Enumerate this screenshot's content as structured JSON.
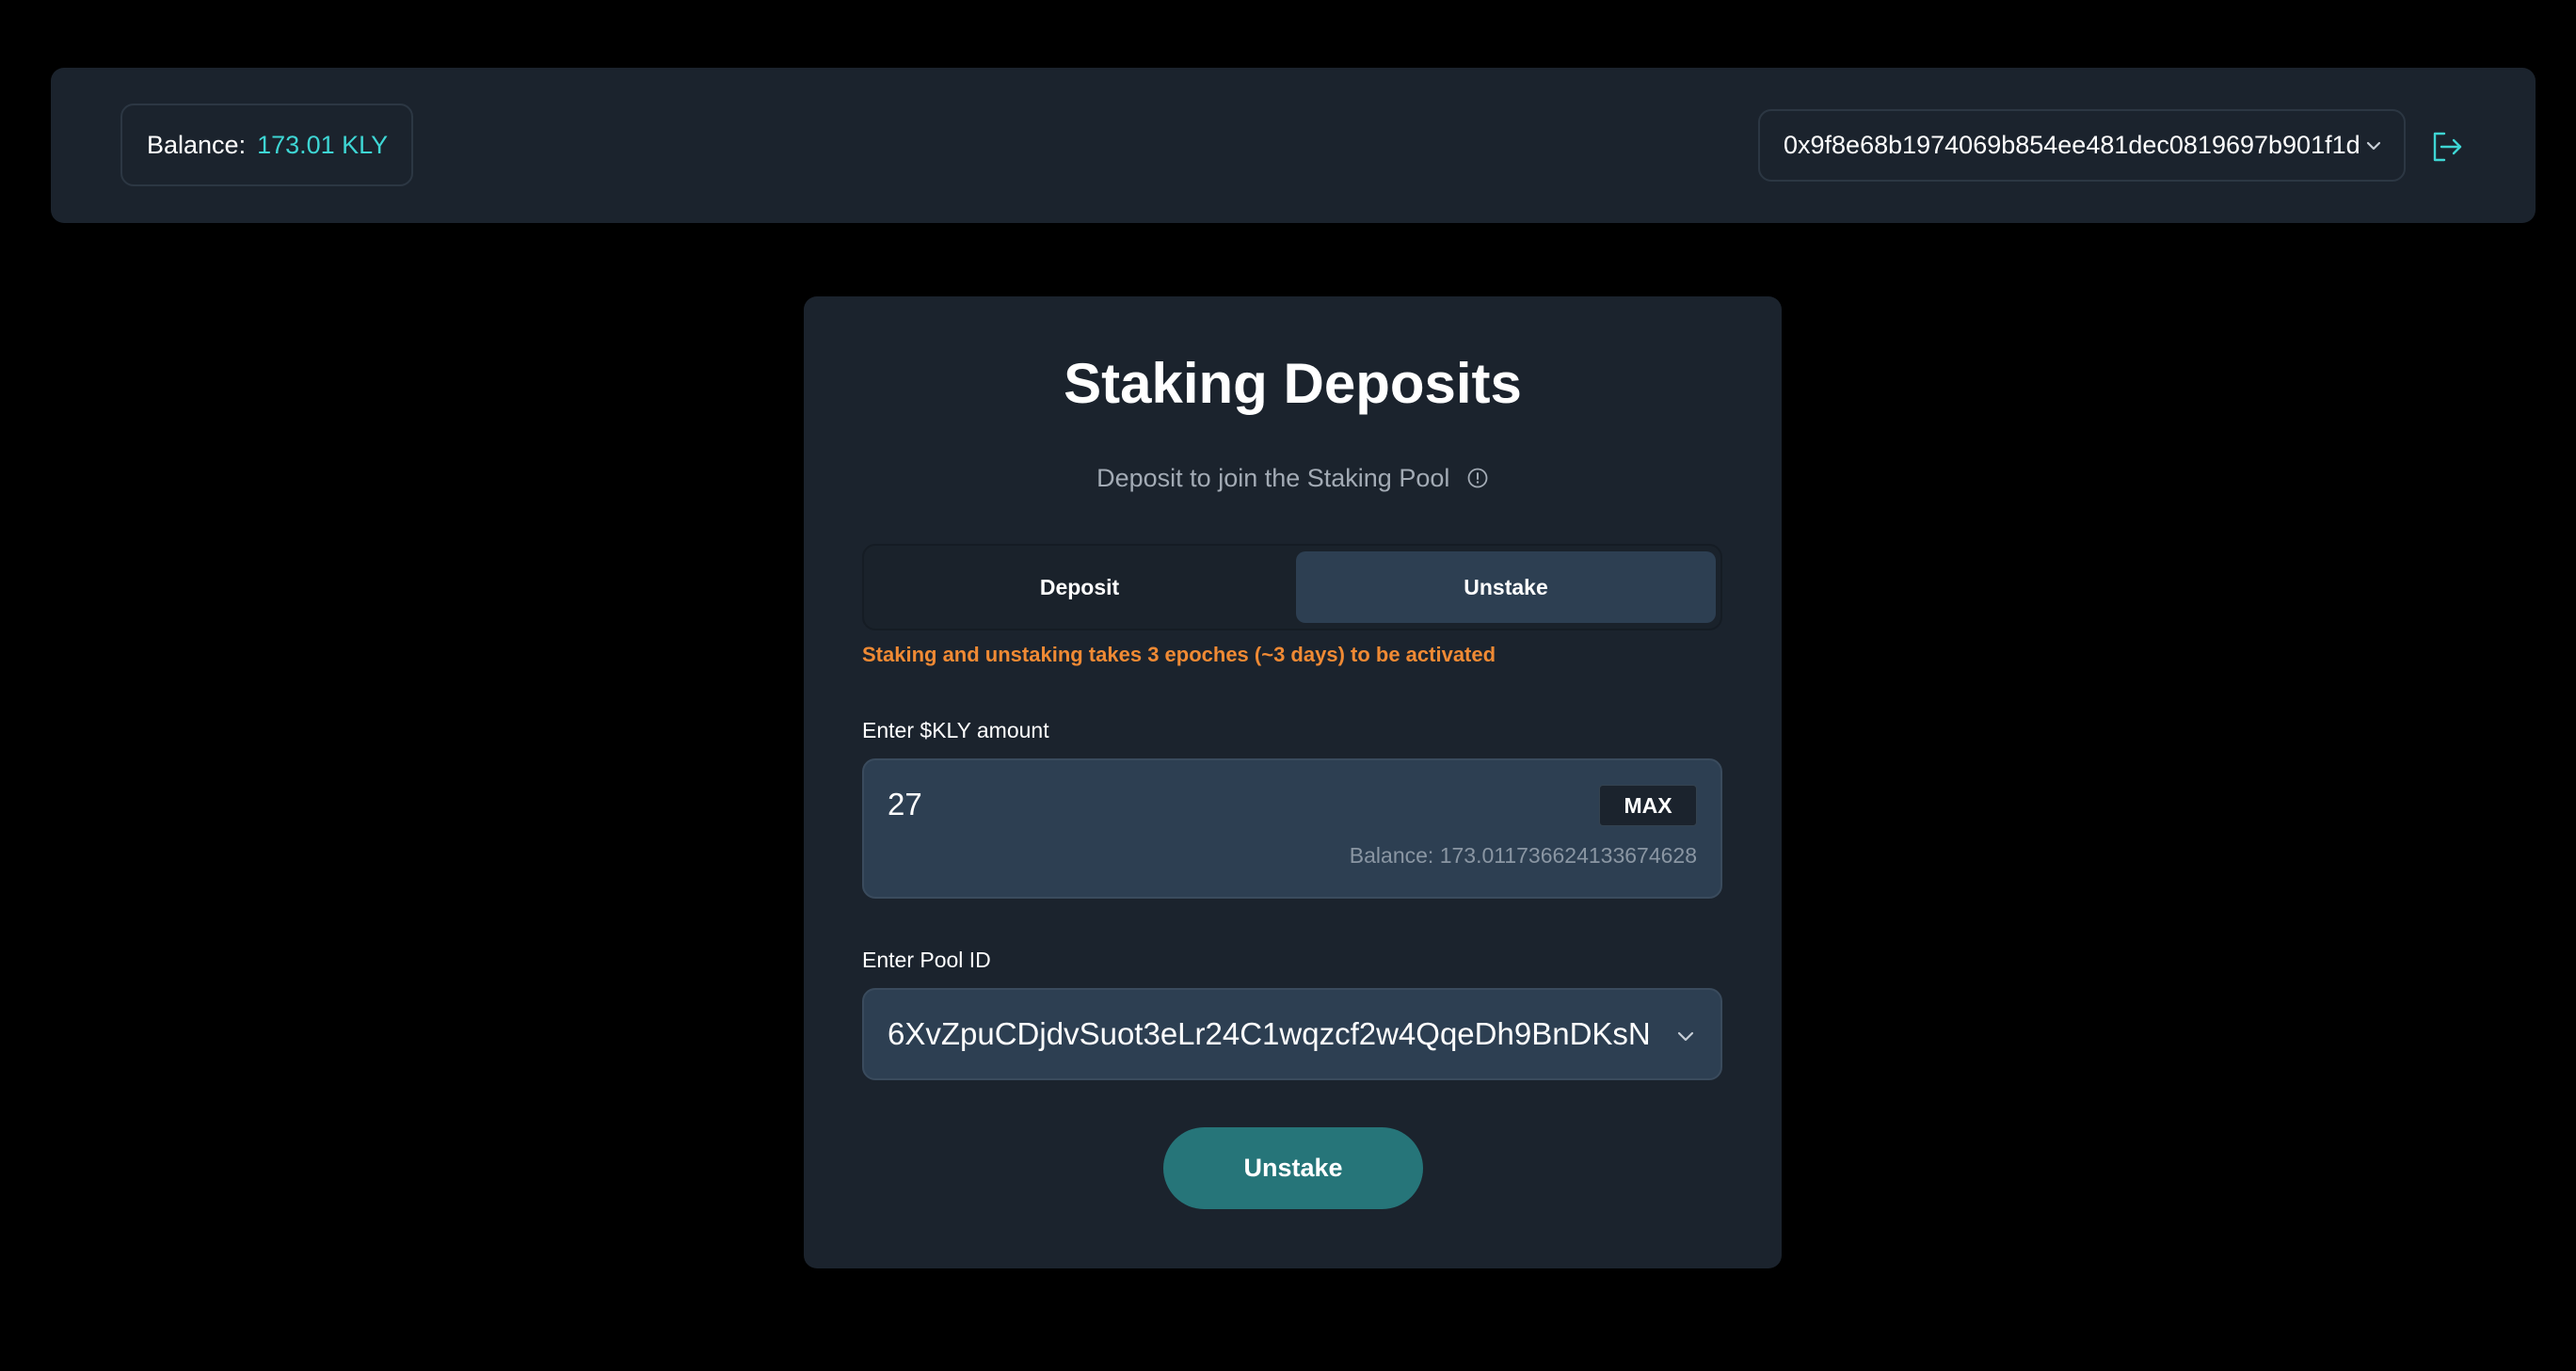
{
  "header": {
    "balance_label": "Balance:",
    "balance_value": "173.01 KLY",
    "wallet_address": "0x9f8e68b1974069b854ee481dec0819697b901f1d",
    "wallet_chevron_icon": "chevron-down-icon",
    "logout_icon": "logout-icon"
  },
  "card": {
    "title": "Staking Deposits",
    "subtitle": "Deposit to join the Staking Pool",
    "info_icon": "info-icon",
    "tabs": [
      {
        "label": "Deposit",
        "active": false
      },
      {
        "label": "Unstake",
        "active": true
      }
    ],
    "warning": "Staking and unstaking takes 3 epoches (~3 days) to be activated",
    "amount_label": "Enter $KLY amount",
    "amount_value": "27",
    "max_label": "MAX",
    "amount_balance": "Balance: 173.011736624133674628",
    "pool_label": "Enter Pool ID",
    "pool_value": "6XvZpuCDjdvSuot3eLr24C1wqzcf2w4QqeDh9BnDKsN",
    "pool_chevron_icon": "chevron-down-icon",
    "submit_label": "Unstake"
  },
  "colors": {
    "background": "#000000",
    "panel": "#1b232d",
    "accent_cyan": "#3ed6d4",
    "warning_orange": "#f08a34",
    "button_teal": "#267579",
    "input_bg": "#2d3f52"
  }
}
